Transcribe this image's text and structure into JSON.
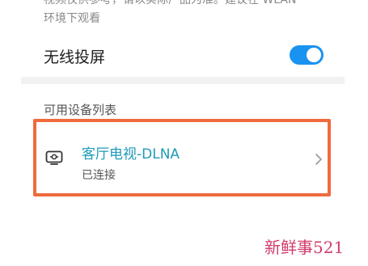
{
  "notice": {
    "line1": "视频仅供参考，请以实际产品为准。建议在 WLAN",
    "line2": "环境下观看"
  },
  "wireless_cast": {
    "label": "无线投屏",
    "enabled": true
  },
  "device_list": {
    "title": "可用设备列表",
    "devices": [
      {
        "name": "客厅电视-DLNA",
        "status": "已连接",
        "icon": "tv-cast-icon"
      }
    ]
  },
  "watermark": "新鲜事521",
  "colors": {
    "toggle_on": "#1a93f0",
    "device_name": "#1f9ab8",
    "highlight_border": "#ef6a3d",
    "watermark": "#d13b6a"
  }
}
